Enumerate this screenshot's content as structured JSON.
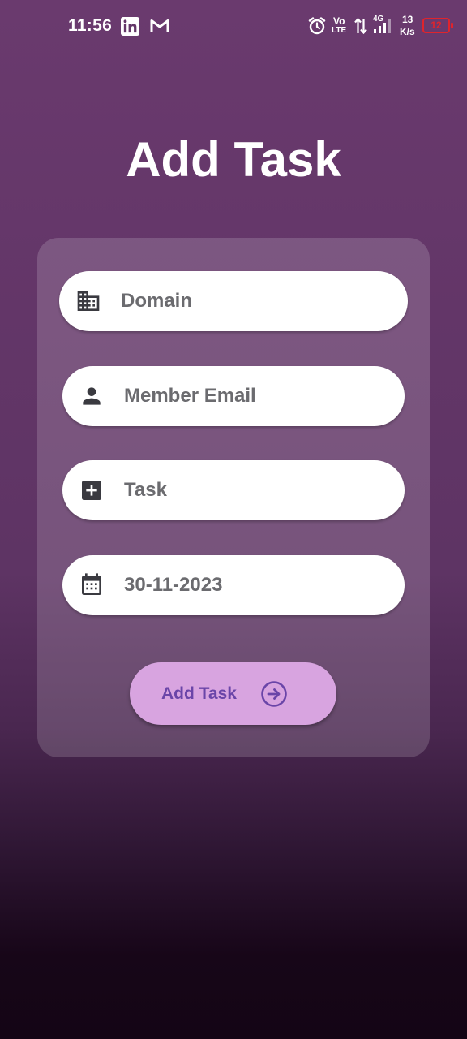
{
  "status_bar": {
    "time": "11:56",
    "network_rate_value": "13",
    "network_rate_unit": "K/s",
    "battery_level": "12",
    "volte_top": "Vo",
    "volte_bottom": "LTE",
    "signal_type": "4G",
    "icons": [
      "linkedin-icon",
      "gmail-icon",
      "alarm-icon",
      "volte-icon",
      "data-transfer-icon",
      "signal-icon",
      "battery-icon"
    ]
  },
  "page": {
    "title": "Add Task"
  },
  "form": {
    "fields": [
      {
        "icon": "building-icon",
        "placeholder": "Domain",
        "value": ""
      },
      {
        "icon": "person-icon",
        "placeholder": "Member Email",
        "value": ""
      },
      {
        "icon": "add-box-icon",
        "placeholder": "Task",
        "value": ""
      },
      {
        "icon": "calendar-icon",
        "placeholder": "",
        "value": "30-11-2023"
      }
    ],
    "submit": {
      "label": "Add Task",
      "icon": "arrow-circle-right-icon"
    }
  },
  "colors": {
    "background_top": "#6a3a6e",
    "background_bottom": "#140515",
    "button_bg": "#d8a4e0",
    "button_text": "#6a45a8",
    "field_text": "#6b6b6f",
    "icon_color": "#3a3a40",
    "battery_warning": "#e0242c"
  }
}
